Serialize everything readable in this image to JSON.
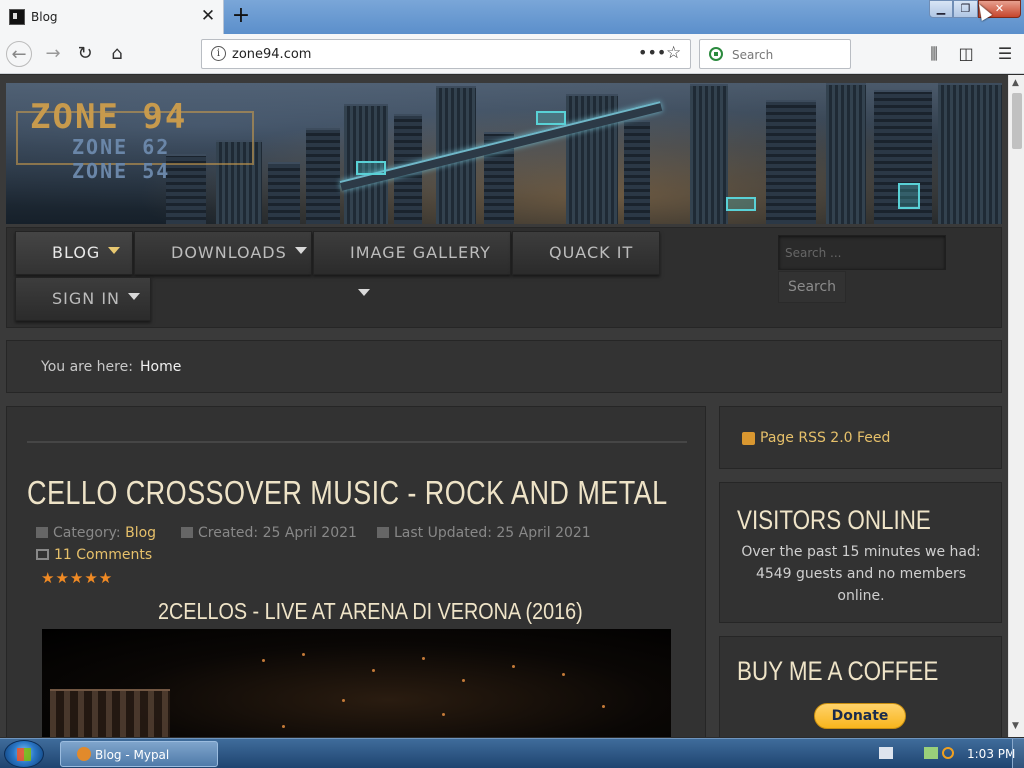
{
  "browser": {
    "tab_title": "Blog",
    "new_tab_icon": "plus-icon",
    "url": "zone94.com",
    "search_placeholder": "Search",
    "window_controls": [
      "minimize",
      "restore",
      "close"
    ]
  },
  "site": {
    "logo": {
      "main": "ZONE 94",
      "sub1": "ZONE 62",
      "sub2": "ZONE 54"
    },
    "menu": {
      "items": [
        {
          "label": "BLOG",
          "has_dropdown": true,
          "active": true
        },
        {
          "label": "DOWNLOADS",
          "has_dropdown": true,
          "active": false
        },
        {
          "label": "IMAGE GALLERY",
          "has_dropdown": true,
          "active": false
        },
        {
          "label": "QUACK IT",
          "has_dropdown": false,
          "active": false
        },
        {
          "label": "SIGN IN",
          "has_dropdown": true,
          "active": false
        }
      ],
      "search_placeholder": "Search ...",
      "search_button": "Search"
    },
    "breadcrumb": {
      "label": "You are here:",
      "current": "Home"
    },
    "article": {
      "title": "CELLO CROSSOVER MUSIC - ROCK AND METAL",
      "category_label": "Category:",
      "category": "Blog",
      "created": "Created: 25 April 2021",
      "updated": "Last Updated: 25 April 2021",
      "comments": "11 Comments",
      "rating": 5,
      "stars": "★★★★★",
      "video_title": "2CELLOS - LIVE AT ARENA DI VERONA (2016)"
    },
    "sidebar": {
      "rss": "Page RSS 2.0 Feed",
      "visitors_title": "VISITORS ONLINE",
      "visitors_text": "Over the past 15 minutes we had: 4549 guests and no members online.",
      "coffee_title": "BUY ME A COFFEE",
      "donate_label": "Donate"
    }
  },
  "taskbar": {
    "window_label": "Blog - Mypal",
    "clock": "1:03 PM"
  },
  "colors": {
    "accent_gold": "#e6c06a",
    "star_orange": "#f08a24",
    "panel_bg": "#323232"
  }
}
